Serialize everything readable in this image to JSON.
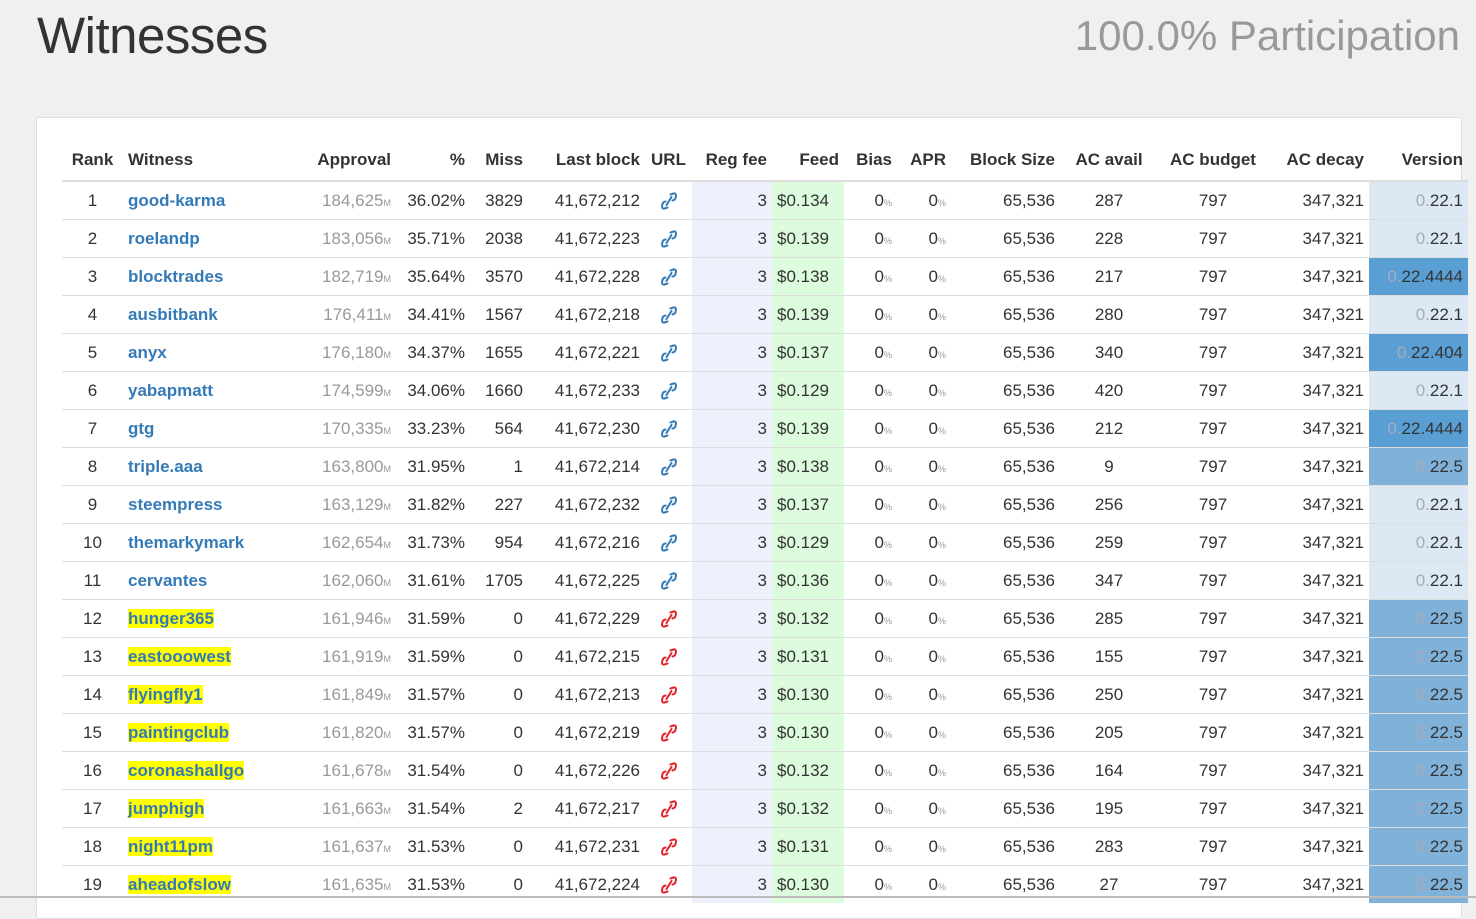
{
  "page": {
    "title": "Witnesses",
    "participation": "100.0% Participation"
  },
  "colors": {
    "link_blue": "#337ab7",
    "link_red": "#e0232a",
    "highlight_yellow": "#ffff00",
    "feed_green": "#ddfbdd",
    "regfee_lavender": "#eef0fb",
    "version_light": "#dce9f4",
    "version_mid": "#7fb1d9",
    "version_dark": "#5a9fd4"
  },
  "table": {
    "headers": [
      "Rank",
      "Witness",
      "Approval",
      "%",
      "Miss",
      "Last block",
      "URL",
      "Reg fee",
      "Feed",
      "Bias",
      "APR",
      "Block Size",
      "AC avail",
      "AC budget",
      "AC decay",
      "Version"
    ],
    "approval_unit": "M",
    "bias_unit": "%",
    "apr_unit": "%",
    "rows": [
      {
        "rank": "1",
        "witness": "good-karma",
        "highlight": false,
        "approval": "184,625",
        "pct": "36.02%",
        "miss": "3829",
        "last_block": "41,672,212",
        "url_icon": "link-blue-icon",
        "reg_fee": "3",
        "feed": "$0.134",
        "bias": "0",
        "apr": "0",
        "block_size": "65,536",
        "ac_avail": "287",
        "ac_budget": "797",
        "ac_decay": "347,321",
        "version_prefix": "0.",
        "version_rest": "22.1",
        "version_shade": "light"
      },
      {
        "rank": "2",
        "witness": "roelandp",
        "highlight": false,
        "approval": "183,056",
        "pct": "35.71%",
        "miss": "2038",
        "last_block": "41,672,223",
        "url_icon": "link-blue-icon",
        "reg_fee": "3",
        "feed": "$0.139",
        "bias": "0",
        "apr": "0",
        "block_size": "65,536",
        "ac_avail": "228",
        "ac_budget": "797",
        "ac_decay": "347,321",
        "version_prefix": "0.",
        "version_rest": "22.1",
        "version_shade": "light"
      },
      {
        "rank": "3",
        "witness": "blocktrades",
        "highlight": false,
        "approval": "182,719",
        "pct": "35.64%",
        "miss": "3570",
        "last_block": "41,672,228",
        "url_icon": "link-blue-icon",
        "reg_fee": "3",
        "feed": "$0.138",
        "bias": "0",
        "apr": "0",
        "block_size": "65,536",
        "ac_avail": "217",
        "ac_budget": "797",
        "ac_decay": "347,321",
        "version_prefix": "0.",
        "version_rest": "22.4444",
        "version_shade": "dark"
      },
      {
        "rank": "4",
        "witness": "ausbitbank",
        "highlight": false,
        "approval": "176,411",
        "pct": "34.41%",
        "miss": "1567",
        "last_block": "41,672,218",
        "url_icon": "link-blue-icon",
        "reg_fee": "3",
        "feed": "$0.139",
        "bias": "0",
        "apr": "0",
        "block_size": "65,536",
        "ac_avail": "280",
        "ac_budget": "797",
        "ac_decay": "347,321",
        "version_prefix": "0.",
        "version_rest": "22.1",
        "version_shade": "light"
      },
      {
        "rank": "5",
        "witness": "anyx",
        "highlight": false,
        "approval": "176,180",
        "pct": "34.37%",
        "miss": "1655",
        "last_block": "41,672,221",
        "url_icon": "link-blue-icon",
        "reg_fee": "3",
        "feed": "$0.137",
        "bias": "0",
        "apr": "0",
        "block_size": "65,536",
        "ac_avail": "340",
        "ac_budget": "797",
        "ac_decay": "347,321",
        "version_prefix": "0.",
        "version_rest": "22.404",
        "version_shade": "dark"
      },
      {
        "rank": "6",
        "witness": "yabapmatt",
        "highlight": false,
        "approval": "174,599",
        "pct": "34.06%",
        "miss": "1660",
        "last_block": "41,672,233",
        "url_icon": "link-blue-icon",
        "reg_fee": "3",
        "feed": "$0.129",
        "bias": "0",
        "apr": "0",
        "block_size": "65,536",
        "ac_avail": "420",
        "ac_budget": "797",
        "ac_decay": "347,321",
        "version_prefix": "0.",
        "version_rest": "22.1",
        "version_shade": "light"
      },
      {
        "rank": "7",
        "witness": "gtg",
        "highlight": false,
        "approval": "170,335",
        "pct": "33.23%",
        "miss": "564",
        "last_block": "41,672,230",
        "url_icon": "link-blue-icon",
        "reg_fee": "3",
        "feed": "$0.139",
        "bias": "0",
        "apr": "0",
        "block_size": "65,536",
        "ac_avail": "212",
        "ac_budget": "797",
        "ac_decay": "347,321",
        "version_prefix": "0.",
        "version_rest": "22.4444",
        "version_shade": "dark"
      },
      {
        "rank": "8",
        "witness": "triple.aaa",
        "highlight": false,
        "approval": "163,800",
        "pct": "31.95%",
        "miss": "1",
        "last_block": "41,672,214",
        "url_icon": "link-blue-icon",
        "reg_fee": "3",
        "feed": "$0.138",
        "bias": "0",
        "apr": "0",
        "block_size": "65,536",
        "ac_avail": "9",
        "ac_budget": "797",
        "ac_decay": "347,321",
        "version_prefix": "0.",
        "version_rest": "22.5",
        "version_shade": "mid"
      },
      {
        "rank": "9",
        "witness": "steempress",
        "highlight": false,
        "approval": "163,129",
        "pct": "31.82%",
        "miss": "227",
        "last_block": "41,672,232",
        "url_icon": "link-blue-icon",
        "reg_fee": "3",
        "feed": "$0.137",
        "bias": "0",
        "apr": "0",
        "block_size": "65,536",
        "ac_avail": "256",
        "ac_budget": "797",
        "ac_decay": "347,321",
        "version_prefix": "0.",
        "version_rest": "22.1",
        "version_shade": "light"
      },
      {
        "rank": "10",
        "witness": "themarkymark",
        "highlight": false,
        "approval": "162,654",
        "pct": "31.73%",
        "miss": "954",
        "last_block": "41,672,216",
        "url_icon": "link-blue-icon",
        "reg_fee": "3",
        "feed": "$0.129",
        "bias": "0",
        "apr": "0",
        "block_size": "65,536",
        "ac_avail": "259",
        "ac_budget": "797",
        "ac_decay": "347,321",
        "version_prefix": "0.",
        "version_rest": "22.1",
        "version_shade": "light"
      },
      {
        "rank": "11",
        "witness": "cervantes",
        "highlight": false,
        "approval": "162,060",
        "pct": "31.61%",
        "miss": "1705",
        "last_block": "41,672,225",
        "url_icon": "link-blue-icon",
        "reg_fee": "3",
        "feed": "$0.136",
        "bias": "0",
        "apr": "0",
        "block_size": "65,536",
        "ac_avail": "347",
        "ac_budget": "797",
        "ac_decay": "347,321",
        "version_prefix": "0.",
        "version_rest": "22.1",
        "version_shade": "light"
      },
      {
        "rank": "12",
        "witness": "hunger365",
        "highlight": true,
        "approval": "161,946",
        "pct": "31.59%",
        "miss": "0",
        "last_block": "41,672,229",
        "url_icon": "link-red-icon",
        "reg_fee": "3",
        "feed": "$0.132",
        "bias": "0",
        "apr": "0",
        "block_size": "65,536",
        "ac_avail": "285",
        "ac_budget": "797",
        "ac_decay": "347,321",
        "version_prefix": "0.",
        "version_rest": "22.5",
        "version_shade": "mid"
      },
      {
        "rank": "13",
        "witness": "eastooowest",
        "highlight": true,
        "approval": "161,919",
        "pct": "31.59%",
        "miss": "0",
        "last_block": "41,672,215",
        "url_icon": "link-red-icon",
        "reg_fee": "3",
        "feed": "$0.131",
        "bias": "0",
        "apr": "0",
        "block_size": "65,536",
        "ac_avail": "155",
        "ac_budget": "797",
        "ac_decay": "347,321",
        "version_prefix": "0.",
        "version_rest": "22.5",
        "version_shade": "mid"
      },
      {
        "rank": "14",
        "witness": "flyingfly1",
        "highlight": true,
        "approval": "161,849",
        "pct": "31.57%",
        "miss": "0",
        "last_block": "41,672,213",
        "url_icon": "link-red-icon",
        "reg_fee": "3",
        "feed": "$0.130",
        "bias": "0",
        "apr": "0",
        "block_size": "65,536",
        "ac_avail": "250",
        "ac_budget": "797",
        "ac_decay": "347,321",
        "version_prefix": "0.",
        "version_rest": "22.5",
        "version_shade": "mid"
      },
      {
        "rank": "15",
        "witness": "paintingclub",
        "highlight": true,
        "approval": "161,820",
        "pct": "31.57%",
        "miss": "0",
        "last_block": "41,672,219",
        "url_icon": "link-red-icon",
        "reg_fee": "3",
        "feed": "$0.130",
        "bias": "0",
        "apr": "0",
        "block_size": "65,536",
        "ac_avail": "205",
        "ac_budget": "797",
        "ac_decay": "347,321",
        "version_prefix": "0.",
        "version_rest": "22.5",
        "version_shade": "mid"
      },
      {
        "rank": "16",
        "witness": "coronashallgo",
        "highlight": true,
        "approval": "161,678",
        "pct": "31.54%",
        "miss": "0",
        "last_block": "41,672,226",
        "url_icon": "link-red-icon",
        "reg_fee": "3",
        "feed": "$0.132",
        "bias": "0",
        "apr": "0",
        "block_size": "65,536",
        "ac_avail": "164",
        "ac_budget": "797",
        "ac_decay": "347,321",
        "version_prefix": "0.",
        "version_rest": "22.5",
        "version_shade": "mid"
      },
      {
        "rank": "17",
        "witness": "jumphigh",
        "highlight": true,
        "approval": "161,663",
        "pct": "31.54%",
        "miss": "2",
        "last_block": "41,672,217",
        "url_icon": "link-red-icon",
        "reg_fee": "3",
        "feed": "$0.132",
        "bias": "0",
        "apr": "0",
        "block_size": "65,536",
        "ac_avail": "195",
        "ac_budget": "797",
        "ac_decay": "347,321",
        "version_prefix": "0.",
        "version_rest": "22.5",
        "version_shade": "mid"
      },
      {
        "rank": "18",
        "witness": "night11pm",
        "highlight": true,
        "approval": "161,637",
        "pct": "31.53%",
        "miss": "0",
        "last_block": "41,672,231",
        "url_icon": "link-red-icon",
        "reg_fee": "3",
        "feed": "$0.131",
        "bias": "0",
        "apr": "0",
        "block_size": "65,536",
        "ac_avail": "283",
        "ac_budget": "797",
        "ac_decay": "347,321",
        "version_prefix": "0.",
        "version_rest": "22.5",
        "version_shade": "mid"
      },
      {
        "rank": "19",
        "witness": "aheadofslow",
        "highlight": true,
        "approval": "161,635",
        "pct": "31.53%",
        "miss": "0",
        "last_block": "41,672,224",
        "url_icon": "link-red-icon",
        "reg_fee": "3",
        "feed": "$0.130",
        "bias": "0",
        "apr": "0",
        "block_size": "65,536",
        "ac_avail": "27",
        "ac_budget": "797",
        "ac_decay": "347,321",
        "version_prefix": "0.",
        "version_rest": "22.5",
        "version_shade": "mid"
      }
    ]
  }
}
